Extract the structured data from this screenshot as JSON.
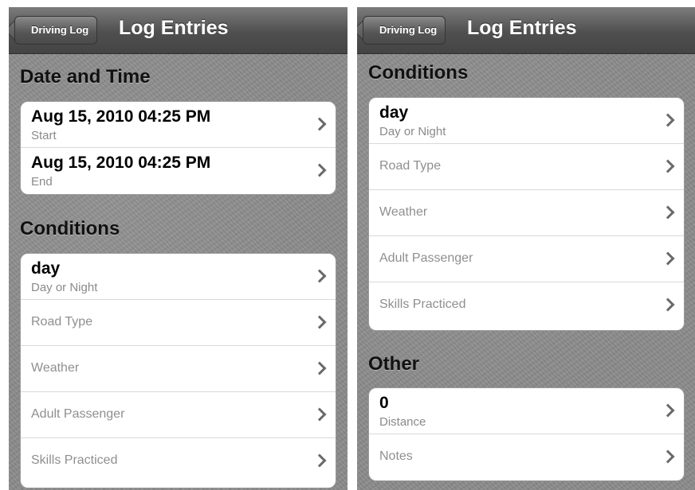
{
  "left": {
    "back_label": "Driving Log",
    "title": "Log Entries",
    "date_section": "Date and Time",
    "start_value": "Aug 15, 2010 04:25 PM",
    "start_label": "Start",
    "end_value": "Aug 15, 2010 04:25 PM",
    "end_label": "End",
    "conditions_section": "Conditions",
    "day_value": "day",
    "day_label": "Day or Night",
    "road_type": "Road Type",
    "weather": "Weather",
    "adult_passenger": "Adult Passenger",
    "skills_practiced": "Skills Practiced"
  },
  "right": {
    "back_label": "Driving Log",
    "title": "Log Entries",
    "conditions_section": "Conditions",
    "day_value": "day",
    "day_label": "Day or Night",
    "road_type": "Road Type",
    "weather": "Weather",
    "adult_passenger": "Adult Passenger",
    "skills_practiced": "Skills Practiced",
    "other_section": "Other",
    "distance_value": "0",
    "distance_label": "Distance",
    "notes": "Notes"
  },
  "icons": {
    "back": "back-arrow-icon",
    "disclosure": "chevron-right-icon"
  },
  "colors": {
    "navbar": "#555555",
    "background": "#8e8e8e",
    "cell": "#ffffff",
    "chevron": "#6a6a6a"
  }
}
